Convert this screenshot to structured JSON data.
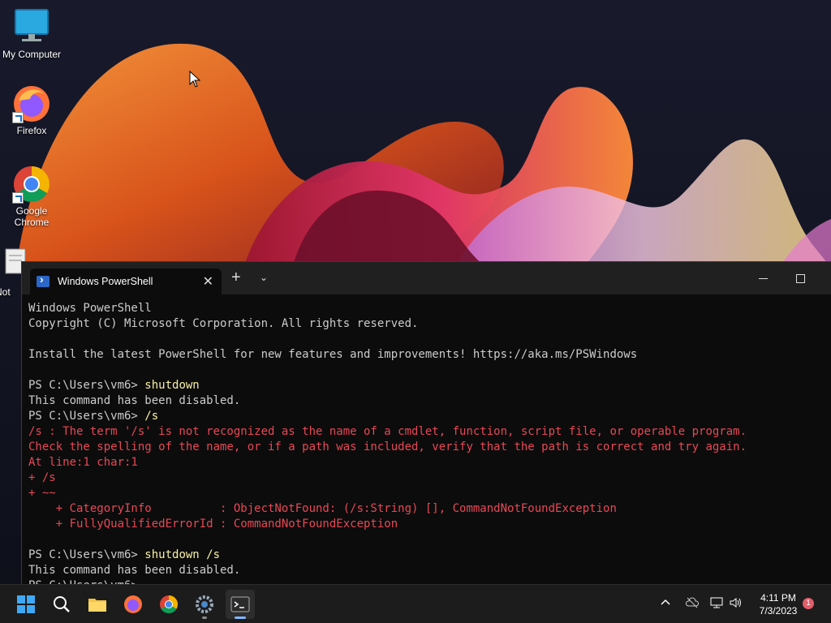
{
  "desktop": {
    "icons": [
      {
        "label": "My Computer"
      },
      {
        "label": "Firefox"
      },
      {
        "label": "Google Chrome"
      },
      {
        "label": "Not"
      }
    ]
  },
  "terminal": {
    "tab_title": "Windows PowerShell",
    "new_tab": "+",
    "lines": [
      {
        "text": "Windows PowerShell",
        "style": "normal"
      },
      {
        "text": "Copyright (C) Microsoft Corporation. All rights reserved.",
        "style": "normal"
      },
      {
        "text": "",
        "style": "normal"
      },
      {
        "text": "Install the latest PowerShell for new features and improvements! https://aka.ms/PSWindows",
        "style": "normal"
      },
      {
        "text": "",
        "style": "normal"
      },
      {
        "prompt": "PS C:\\Users\\vm6> ",
        "text": "shutdown",
        "style": "cmd"
      },
      {
        "text": "This command has been disabled.",
        "style": "normal"
      },
      {
        "prompt": "PS C:\\Users\\vm6> ",
        "text": "/s",
        "style": "cmd"
      },
      {
        "text": "/s : The term '/s' is not recognized as the name of a cmdlet, function, script file, or operable program.",
        "style": "err"
      },
      {
        "text": "Check the spelling of the name, or if a path was included, verify that the path is correct and try again.",
        "style": "err"
      },
      {
        "text": "At line:1 char:1",
        "style": "err"
      },
      {
        "text": "+ /s",
        "style": "err"
      },
      {
        "text": "+ ~~",
        "style": "err"
      },
      {
        "text": "    + CategoryInfo          : ObjectNotFound: (/s:String) [], CommandNotFoundException",
        "style": "err"
      },
      {
        "text": "    + FullyQualifiedErrorId : CommandNotFoundException",
        "style": "err"
      },
      {
        "text": "",
        "style": "normal"
      },
      {
        "prompt": "PS C:\\Users\\vm6> ",
        "text": "shutdown /s",
        "style": "cmd"
      },
      {
        "text": "This command has been disabled.",
        "style": "normal"
      },
      {
        "prompt": "PS C:\\Users\\vm6> ",
        "text": "",
        "style": "cmd"
      }
    ]
  },
  "taskbar": {
    "items": [
      "start-icon",
      "search-icon",
      "file-explorer-icon",
      "firefox-icon",
      "chrome-icon",
      "settings-icon",
      "terminal-icon"
    ],
    "clock_time": "4:11 PM",
    "clock_date": "7/3/2023",
    "notification_count": "1"
  },
  "colors": {
    "console_bg": "#0c0c0c",
    "console_text": "#cccccc",
    "error_text": "#e74856",
    "command_text": "#f9f1a5",
    "taskbar_bg": "#1c1c1c"
  }
}
